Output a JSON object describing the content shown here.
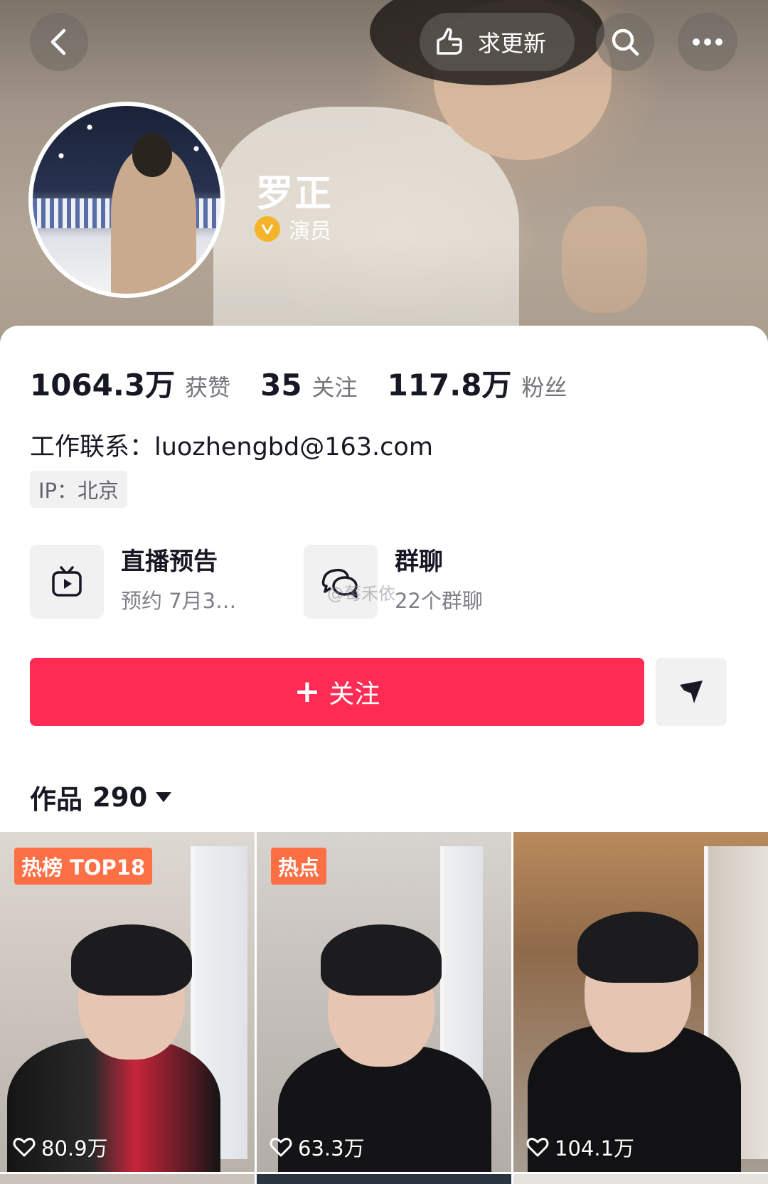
{
  "header": {
    "update_label": "求更新",
    "icons": {
      "back": "chevron-left-icon",
      "search": "search-icon",
      "more": "more-dots-icon",
      "update": "hand-pointer-icon"
    }
  },
  "profile": {
    "name": "罗正",
    "verify_label": "演员",
    "verify_badge_color": "#f4b42a"
  },
  "stats": [
    {
      "value": "1064.3万",
      "label": "获赞"
    },
    {
      "value": "35",
      "label": "关注"
    },
    {
      "value": "117.8万",
      "label": "粉丝"
    }
  ],
  "contact": "工作联系：luozhengbd@163.com",
  "ip": "IP：北京",
  "features": {
    "live": {
      "title": "直播预告",
      "subtitle": "预约 7月3…"
    },
    "group": {
      "title": "群聊",
      "subtitle": "22个群聊"
    }
  },
  "actions": {
    "follow_label": "关注",
    "follow_color": "#fe2c55"
  },
  "works": {
    "label": "作品",
    "count": "290"
  },
  "videos": [
    {
      "badge": "热榜 TOP18",
      "likes": "80.9万"
    },
    {
      "badge": "热点",
      "likes": "63.3万"
    },
    {
      "badge": "",
      "likes": "104.1万"
    }
  ],
  "watermark": "@莓禾依"
}
